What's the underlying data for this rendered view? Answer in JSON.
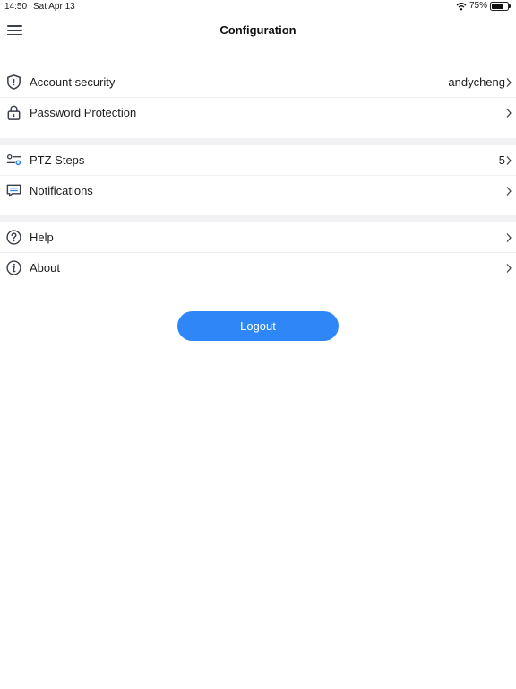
{
  "status_bar": {
    "time": "14:50",
    "date": "Sat Apr 13",
    "battery_text": "75%",
    "battery_level": 0.75
  },
  "nav": {
    "title": "Configuration"
  },
  "groups": [
    {
      "items": [
        {
          "label": "Account security",
          "value": "andycheng",
          "icon": "shield-icon"
        },
        {
          "label": "Password Protection",
          "value": "",
          "icon": "lock-icon"
        }
      ]
    },
    {
      "items": [
        {
          "label": "PTZ Steps",
          "value": "5",
          "icon": "sliders-icon"
        },
        {
          "label": "Notifications",
          "value": "",
          "icon": "message-icon"
        }
      ]
    },
    {
      "items": [
        {
          "label": "Help",
          "value": "",
          "icon": "help-icon"
        },
        {
          "label": "About",
          "value": "",
          "icon": "info-icon"
        }
      ]
    }
  ],
  "logout_label": "Logout",
  "colors": {
    "accent": "#2f86f6",
    "icon": "#3a3f4a",
    "divider": "#f1f1f3"
  }
}
